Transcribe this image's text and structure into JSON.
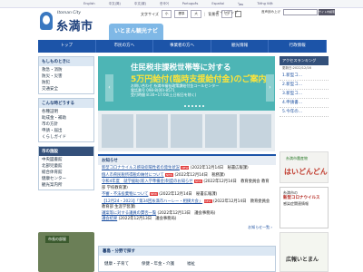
{
  "top_langs": [
    "English",
    "中文(简)",
    "中文(繁)",
    "한국어",
    "Português",
    "Español",
    "ไทย",
    "Tiếng Việt"
  ],
  "logo": {
    "en": "Itoman City",
    "jp": "糸満市"
  },
  "controls": {
    "font_label": "文字サイズ",
    "small": "小",
    "std": "標準",
    "large": "大",
    "bg_label": "背景色",
    "bg_color": "白"
  },
  "sitemap": "サイトマップ",
  "search": {
    "label": "音声読み上げ",
    "button": "サイト内検索"
  },
  "nav": [
    "トップ",
    "市民の方へ",
    "事業者の方へ",
    "観光情報",
    "行政情報"
  ],
  "mascot_text": "いとまん観光ナビ",
  "left_menu": {
    "title": "もしものときに",
    "items": [
      "救急・消防",
      "防災・災害",
      "防犯",
      "交通安全"
    ]
  },
  "left_menu2": {
    "title": "こんな時どうする",
    "items": [
      "各種証明",
      "助成金・補助",
      "市の方針",
      "申請・届出",
      "くらしガイド"
    ]
  },
  "left_menu3": {
    "title": "市の施設",
    "items": [
      "中央図書館",
      "北部児童館",
      "総合体育館",
      "健康センター",
      "観光案内所"
    ]
  },
  "lower_banner": "市長の部屋",
  "slider": {
    "line1": "住民税非課税世帯等に対する",
    "line2": "5万円給付(臨時支援給付金)のご案内",
    "line3": [
      "お問い合わせ 糸満市福祉政策課給付金コールセンター",
      "電話番号 098-8(00)-8571",
      "受付時間 8:30~17:00(土日祝日を除く)"
    ],
    "prev": "‹",
    "next": "›"
  },
  "news": {
    "title": "お知らせ",
    "items": [
      {
        "text": "新型コロナウイルス感染症陽性者の発生状況",
        "new": "NEW",
        "date": "(2022年12月14日　秘書広報課)"
      },
      {
        "text": "個人市県民税所得税の納付について",
        "new": "NEW",
        "date": "(2022年12月14日　税務課)"
      },
      {
        "text": "令和4年度　就学援助(新入学準備金)制度のお知らせ",
        "new": "NEW",
        "date": "(2022年12月14日　教育委員会 教育部 学校教育課)"
      },
      {
        "text": "不審・不法投棄物について",
        "new": "NEW",
        "date": "(2022年12月14日　秘書広報課)"
      },
      {
        "text": "【12月24・2023】「第34回糸満市ハーレー・相撲大会」",
        "new": "NEW",
        "date": "(2022年12月14日　教育委員会 教育部 生涯学習課)"
      },
      {
        "text": "議案等に対する議員の賛否一覧",
        "new": "",
        "date": "(2022年12月13日　議会事務局)"
      },
      {
        "text": "議会結果",
        "new": "",
        "date": "(2022年12月13日　議会事務局)"
      }
    ],
    "more": "お知らせ一覧 ›"
  },
  "category": {
    "title": "暮島・分野で探す",
    "items": [
      "健康・子育て",
      "保健・年金・介護",
      "福祉"
    ]
  },
  "ranking": {
    "title": "アクセスランキング",
    "date": "更新日:2022/12/16",
    "items": [
      "1.新型コ...",
      "2.新型コ...",
      "3.新型コ...",
      "4.申請書...",
      "5.今年の..."
    ]
  },
  "right_banner": {
    "small": "糸満市農産物",
    "big": "はいどんどん"
  },
  "right_info": {
    "l1": "糸満市の",
    "l2": "新型コロナウイルス",
    "l3": "感染症関連情報"
  },
  "right_bottom": "広報いとまん"
}
